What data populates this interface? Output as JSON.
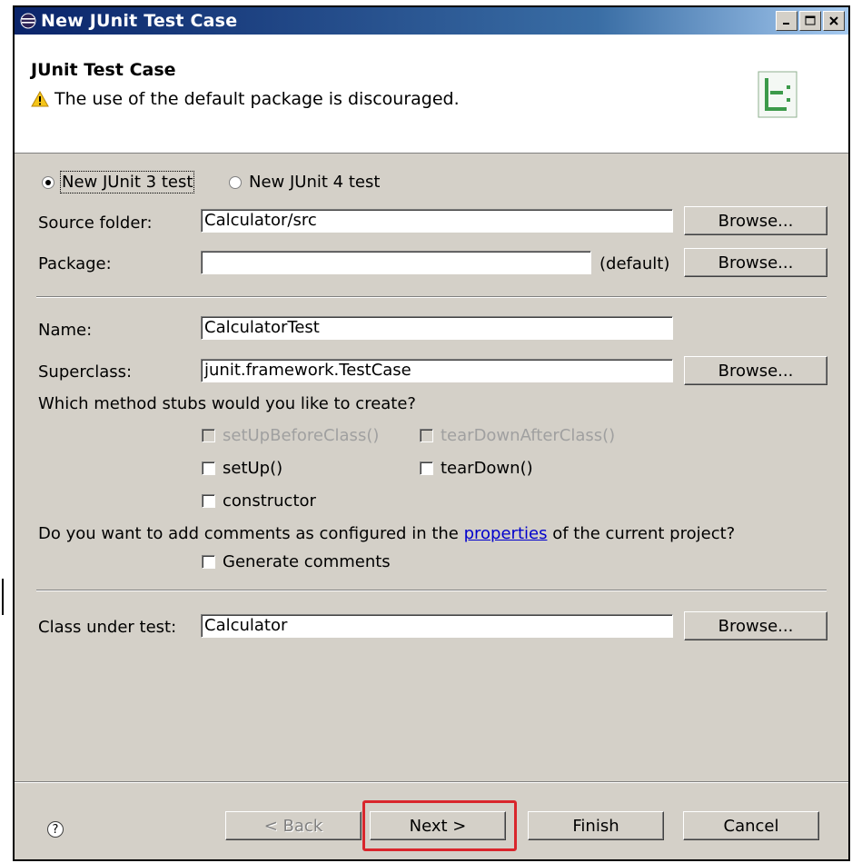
{
  "window": {
    "title": "New JUnit Test Case",
    "controls": [
      "minimize",
      "maximize",
      "close"
    ]
  },
  "header": {
    "title": "JUnit Test Case",
    "message": "The use of the default package is discouraged."
  },
  "version": {
    "options": [
      "New JUnit 3 test",
      "New JUnit 4 test"
    ],
    "selected": "New JUnit 3 test"
  },
  "source_folder": {
    "label": "Source folder:",
    "value": "Calculator/src",
    "browse": "Browse..."
  },
  "package": {
    "label": "Package:",
    "value": "",
    "suffix": "(default)",
    "browse": "Browse..."
  },
  "name": {
    "label": "Name:",
    "value": "CalculatorTest"
  },
  "superclass": {
    "label": "Superclass:",
    "value": "junit.framework.TestCase",
    "browse": "Browse..."
  },
  "stubs": {
    "question": "Which method stubs would you like to create?",
    "items": [
      {
        "label": "setUpBeforeClass()",
        "checked": false,
        "enabled": false
      },
      {
        "label": "tearDownAfterClass()",
        "checked": false,
        "enabled": false
      },
      {
        "label": "setUp()",
        "checked": false,
        "enabled": true
      },
      {
        "label": "tearDown()",
        "checked": false,
        "enabled": true
      },
      {
        "label": "constructor",
        "checked": false,
        "enabled": true
      }
    ]
  },
  "comments": {
    "question_prefix": "Do you want to add comments as configured in the",
    "link": "properties",
    "question_suffix": "of the current project?",
    "checkbox": "Generate comments"
  },
  "class_under_test": {
    "label": "Class under test:",
    "value": "Calculator",
    "browse": "Browse..."
  },
  "footer": {
    "back": "< Back",
    "next": "Next >",
    "finish": "Finish",
    "cancel": "Cancel",
    "help_icon": "question-icon",
    "highlight_color": "#d9262c"
  }
}
